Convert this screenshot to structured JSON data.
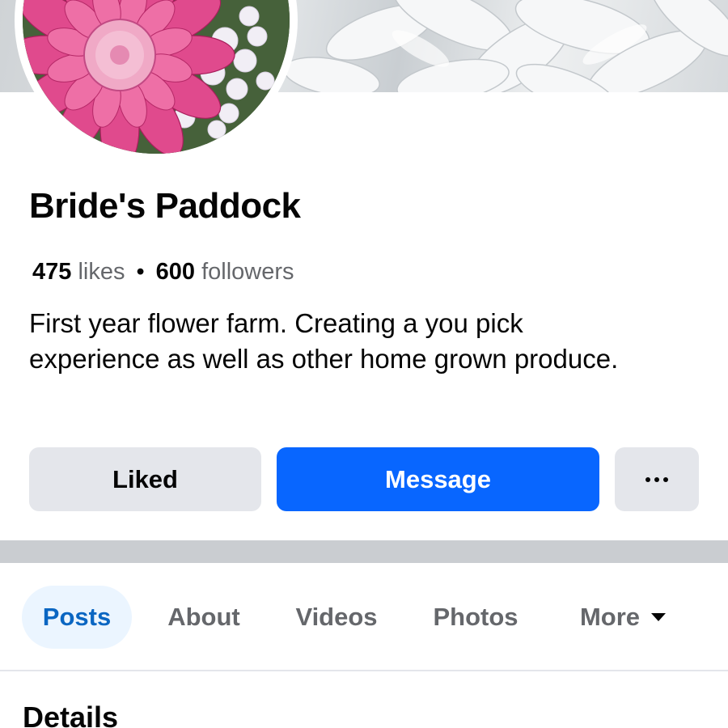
{
  "profile": {
    "name": "Bride's Paddock",
    "likes_count": "475",
    "likes_label": "likes",
    "separator": "•",
    "followers_count": "600",
    "followers_label": "followers",
    "bio_line1": "First year flower farm. Creating a you pick",
    "bio_line2": "experience as well as other home grown produce."
  },
  "actions": {
    "liked_label": "Liked",
    "message_label": "Message",
    "more_icon": "more-horizontal-icon"
  },
  "tabs": [
    {
      "label": "Posts",
      "active": true
    },
    {
      "label": "About"
    },
    {
      "label": "Videos"
    },
    {
      "label": "Photos"
    },
    {
      "label": "More",
      "icon": "caret-down-icon"
    }
  ],
  "section": {
    "heading": "Details"
  },
  "colors": {
    "accent": "#0866ff",
    "active_tab_text": "#0a66c2",
    "active_tab_bg": "#ebf5ff",
    "secondary_button_bg": "#e4e6eb",
    "divider_band": "#cacdd1",
    "muted_text": "#65676b"
  }
}
